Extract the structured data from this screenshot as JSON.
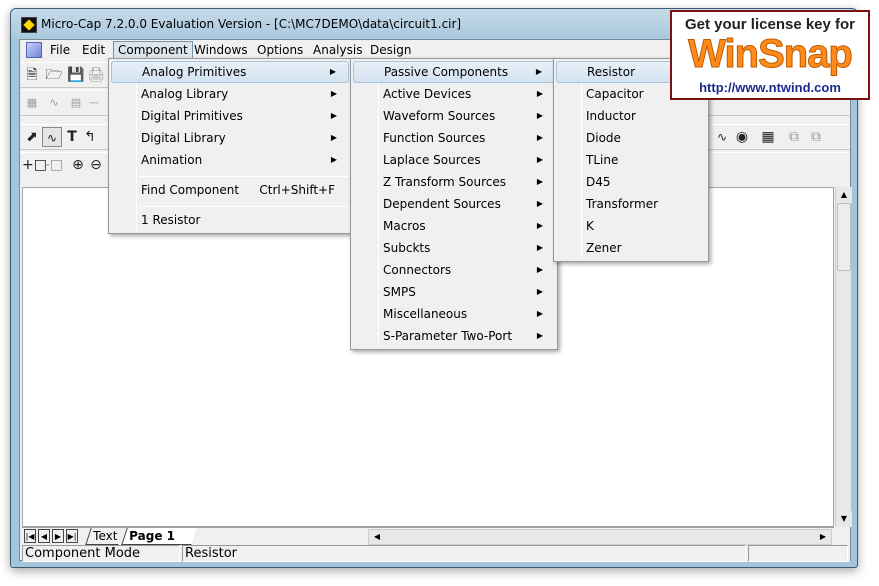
{
  "window": {
    "title": "Micro-Cap 7.2.0.0 Evaluation Version - [C:\\MC7DEMO\\data\\circuit1.cir]"
  },
  "menubar": {
    "file": "File",
    "edit": "Edit",
    "component": "Component",
    "windows": "Windows",
    "options": "Options",
    "analysis": "Analysis",
    "design": "Design"
  },
  "component_menu": {
    "items": [
      "Analog Primitives",
      "Analog Library",
      "Digital Primitives",
      "Digital Library",
      "Animation"
    ],
    "find": {
      "label": "Find Component",
      "shortcut": "Ctrl+Shift+F"
    },
    "recent": "1 Resistor"
  },
  "analog_primitives_menu": {
    "items": [
      "Passive Components",
      "Active Devices",
      "Waveform Sources",
      "Function Sources",
      "Laplace Sources",
      "Z Transform Sources",
      "Dependent Sources",
      "Macros",
      "Subckts",
      "Connectors",
      "SMPS",
      "Miscellaneous",
      "S-Parameter Two-Port"
    ]
  },
  "passive_components_menu": {
    "items": [
      "Resistor",
      "Capacitor",
      "Inductor",
      "Diode",
      "TLine",
      "D45",
      "Transformer",
      "K",
      "Zener"
    ]
  },
  "tabs": {
    "text": "Text",
    "page1": "Page 1"
  },
  "status": {
    "mode": "Component Mode",
    "component": "Resistor"
  },
  "watermark": {
    "headline": "Get your license key for",
    "logo": "WinSnap",
    "url": "http://www.ntwind.com"
  },
  "icons": {
    "new": "new-file-icon",
    "open": "open-folder-icon",
    "save": "save-icon",
    "select": "select-arrow-icon",
    "wire": "wire-icon",
    "text": "text-tool-icon",
    "zoom_in": "zoom-in-icon",
    "find": "binoculars-icon"
  },
  "colors": {
    "menu_highlight": "#d3e2f1",
    "titlebar": "#a8c8de",
    "logo_orange": "#ff8c1a",
    "logo_border": "#7b1111"
  }
}
